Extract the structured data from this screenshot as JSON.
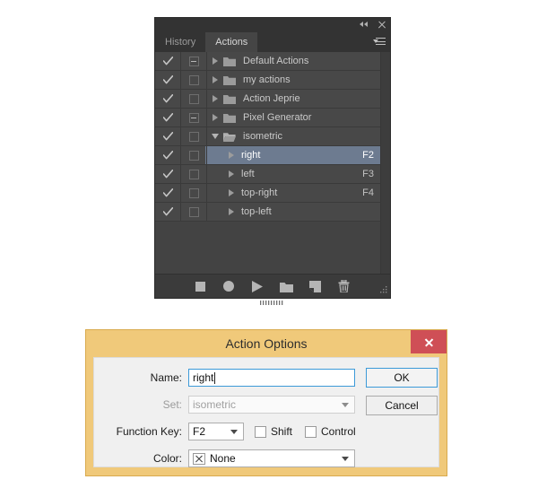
{
  "panel": {
    "titlebar": {
      "collapse_icon": "collapse-double-chevron-icon",
      "close_icon": "close-icon"
    },
    "tabs": [
      {
        "label": "History",
        "active": false
      },
      {
        "label": "Actions",
        "active": true
      }
    ],
    "menu_icon": "panel-menu-icon",
    "rows": [
      {
        "label": "Default Actions",
        "type": "set",
        "checked": true,
        "toggle": "minus",
        "expanded": false,
        "fkey": "",
        "selected": false
      },
      {
        "label": "my actions",
        "type": "set",
        "checked": true,
        "toggle": "empty",
        "expanded": false,
        "fkey": "",
        "selected": false
      },
      {
        "label": "Action Jeprie",
        "type": "set",
        "checked": true,
        "toggle": "empty",
        "expanded": false,
        "fkey": "",
        "selected": false
      },
      {
        "label": "Pixel Generator",
        "type": "set",
        "checked": true,
        "toggle": "minus",
        "expanded": false,
        "fkey": "",
        "selected": false
      },
      {
        "label": "isometric",
        "type": "set",
        "checked": true,
        "toggle": "empty",
        "expanded": true,
        "fkey": "",
        "selected": false
      },
      {
        "label": "right",
        "type": "action",
        "checked": true,
        "toggle": "empty",
        "expanded": false,
        "fkey": "F2",
        "selected": true
      },
      {
        "label": "left",
        "type": "action",
        "checked": true,
        "toggle": "empty",
        "expanded": false,
        "fkey": "F3",
        "selected": false
      },
      {
        "label": "top-right",
        "type": "action",
        "checked": true,
        "toggle": "empty",
        "expanded": false,
        "fkey": "F4",
        "selected": false
      },
      {
        "label": "top-left",
        "type": "action",
        "checked": true,
        "toggle": "empty",
        "expanded": false,
        "fkey": "",
        "selected": false
      }
    ],
    "footer_tools": [
      {
        "name": "stop-button",
        "glyph": "square"
      },
      {
        "name": "record-button",
        "glyph": "circle"
      },
      {
        "name": "play-button",
        "glyph": "triangle"
      },
      {
        "name": "new-set-button",
        "glyph": "folder"
      },
      {
        "name": "new-action-button",
        "glyph": "new-doc"
      },
      {
        "name": "delete-button",
        "glyph": "trash"
      }
    ],
    "colors": {
      "panel_bg": "#454545",
      "row_bg": "#484848",
      "selected_row": "#6d7b90",
      "tab_active_bg": "#454545",
      "tab_inactive_bg": "#333333",
      "text": "#cacaca"
    }
  },
  "dialog": {
    "title": "Action Options",
    "close_label": "Close",
    "fields": {
      "name_label": "Name:",
      "name_value": "right",
      "set_label": "Set:",
      "set_value": "isometric",
      "function_key_label": "Function Key:",
      "function_key_value": "F2",
      "shift_label": "Shift",
      "shift_checked": false,
      "control_label": "Control",
      "control_checked": false,
      "color_label": "Color:",
      "color_value": "None"
    },
    "buttons": {
      "ok": "OK",
      "cancel": "Cancel"
    },
    "colors": {
      "frame": "#f0c97a",
      "body": "#f0f0f0",
      "close_btn": "#cf4f56",
      "focus_border": "#3c9ad8"
    }
  }
}
